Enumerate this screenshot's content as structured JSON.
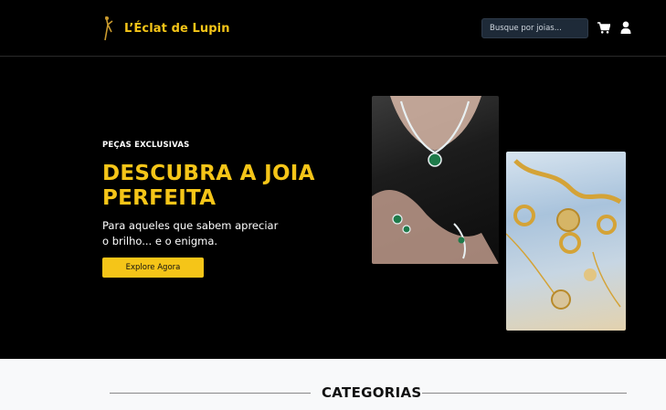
{
  "navbar": {
    "brand_name": "L’Éclat de Lupin",
    "search": {
      "placeholder": "Busque por joias..."
    },
    "icons": {
      "cart": "cart-icon",
      "user": "user-icon",
      "logo": "lupin-logo-icon"
    }
  },
  "hero": {
    "eyebrow": "PEÇAS EXCLUSIVAS",
    "headline": "DESCUBRA A JOIA PERFEITA",
    "subtext_line1": "Para aqueles que sabem apreciar",
    "subtext_line2": "o brilho... e o enigma.",
    "cta_label": "Explore Agora"
  },
  "categories": {
    "title": "CATEGORIAS"
  },
  "colors": {
    "accent": "#f5c518",
    "background": "#000000",
    "section_bg": "#f8f9fa"
  }
}
